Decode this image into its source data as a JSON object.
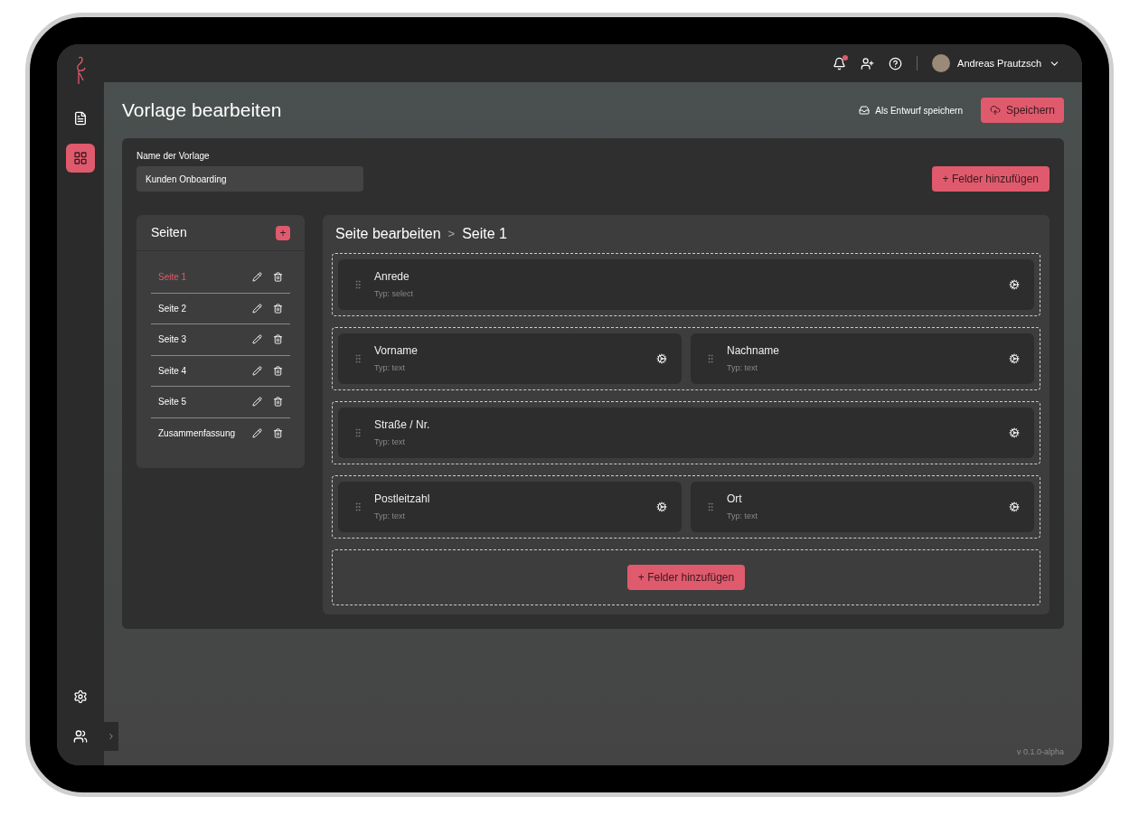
{
  "topbar": {
    "notification_badge": true,
    "user_name": "Andreas Prautzsch"
  },
  "sidebar": {
    "items": [
      {
        "kind": "document",
        "selected": false
      },
      {
        "kind": "apps",
        "selected": true
      }
    ],
    "bottom_items": [
      {
        "kind": "settings"
      },
      {
        "kind": "users"
      }
    ]
  },
  "page": {
    "title": "Vorlage bearbeiten",
    "draft_button": "Als Entwurf speichern",
    "save_button": "Speichern"
  },
  "template": {
    "name_label": "Name der Vorlage",
    "name_value": "Kunden Onboarding",
    "add_fields_button": "+ Felder hinzufügen"
  },
  "pages_panel": {
    "title": "Seiten",
    "add_button": "+",
    "pages": [
      {
        "label": "Seite 1",
        "selected": true
      },
      {
        "label": "Seite 2",
        "selected": false
      },
      {
        "label": "Seite 3",
        "selected": false
      },
      {
        "label": "Seite 4",
        "selected": false
      },
      {
        "label": "Seite 5",
        "selected": false
      },
      {
        "label": "Zusammenfassung",
        "selected": false
      }
    ]
  },
  "editor": {
    "breadcrumb": [
      "Seite bearbeiten",
      "Seite 1"
    ],
    "breadcrumb_separator": ">",
    "rows": [
      {
        "fields": [
          {
            "label": "Anrede",
            "type": "Typ: select"
          }
        ]
      },
      {
        "fields": [
          {
            "label": "Vorname",
            "type": "Typ: text"
          },
          {
            "label": "Nachname",
            "type": "Typ: text"
          }
        ]
      },
      {
        "fields": [
          {
            "label": "Straße / Nr.",
            "type": "Typ: text"
          }
        ]
      },
      {
        "fields": [
          {
            "label": "Postleitzahl",
            "type": "Typ: text"
          },
          {
            "label": "Ort",
            "type": "Typ: text"
          }
        ]
      }
    ],
    "add_fields_button": "+ Felder hinzufügen"
  },
  "version": "v 0.1.0-alpha"
}
